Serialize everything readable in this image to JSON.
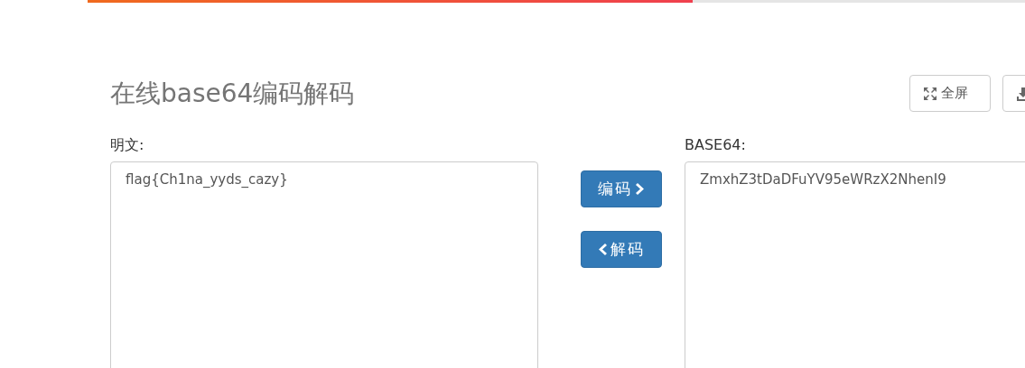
{
  "progress": {
    "level": 0.645
  },
  "title": "在线base64编码解码",
  "toolbar": [
    {
      "kind": "fullscreen",
      "label": "全屏"
    },
    {
      "kind": "download"
    }
  ],
  "plain": {
    "label": "明文:",
    "value": "flag{Ch1na_yyds_cazy}"
  },
  "actions": [
    {
      "kind": "encode",
      "label": "编码"
    },
    {
      "kind": "decode",
      "label": "解码"
    }
  ],
  "encoded": {
    "label": "BASE64:",
    "value": "ZmxhZ3tDaDFuYV95eWRzX2NhenI9"
  }
}
